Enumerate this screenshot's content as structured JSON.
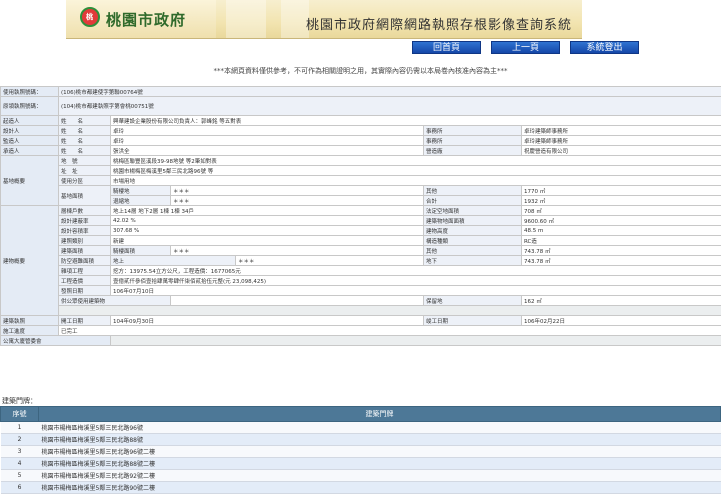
{
  "header": {
    "logo_text": "桃",
    "city_name": "桃園市政府",
    "system_title": "桃園市政府網際網路執照存根影像查詢系統"
  },
  "nav": {
    "home": "回首頁",
    "back": "上一頁",
    "logout": "系統登出"
  },
  "notice": "***本網頁資料僅供參考，不可作為相關證明之用，其實際內容仍需以本局卷內核准內容為主***",
  "license": {
    "use_label": "使用執照號碼：",
    "use_value": "(106)桃市都建使字第聯00764號",
    "orig_label": "原領執照號碼：",
    "orig_value": "(104)桃市都建執照字第會桃00751號"
  },
  "people": {
    "starter": {
      "label": "起造人",
      "name_label": "姓　　名",
      "name": "興華建設企業股份有限公司負責人：郭峰銘 等五對表"
    },
    "designer": {
      "label": "設計人",
      "name_label": "姓　　名",
      "name": "卓玲",
      "office_label": "事務所",
      "office": "卓玲建築師事務所"
    },
    "supervisor": {
      "label": "監造人",
      "name_label": "姓　　名",
      "name": "卓玲",
      "office_label": "事務所",
      "office": "卓玲建築師事務所"
    },
    "contractor": {
      "label": "承造人",
      "name_label": "姓　　名",
      "name": "張洪全",
      "office_label": "營造廠",
      "office": "祝慶營造有限公司"
    }
  },
  "site": {
    "label": "基地概要",
    "lot_label": "地　號",
    "lot": "桃梅區聯豐區溪段39-98地號 等2筆如對表",
    "addr_label": "址　址",
    "addr": "桃園市楊梅區梅溪里5鄰三民北路96號 等",
    "zone_label": "使用分區",
    "zone": "市場用地",
    "area_label": "基地面積",
    "arcade_label": "騎樓地",
    "arcade": "＊＊＊",
    "other_label": "其他",
    "other": "1770 ㎡",
    "setback_label": "退縮地",
    "setback": "＊＊＊",
    "total_label": "合計",
    "total": "1932 ㎡"
  },
  "building": {
    "label": "建物概要",
    "floors_label": "層棟戶數",
    "floors": "地上14層 地下2層 1棟 1棟 34戶",
    "legal_space_label": "法定空地面積",
    "legal_space": "708 ㎡",
    "coverage_label": "設計建蔽率",
    "coverage": "42.02 %",
    "building_area_label": "建築物地面面積",
    "building_area": "9600.60 ㎡",
    "far_label": "設計容積率",
    "far": "307.68 %",
    "height_label": "建物高度",
    "height": "48.5 m",
    "type_label": "建照類別",
    "type": "新建",
    "structure_label": "構造種類",
    "structure": "RC造",
    "floor_area_label": "建築面積",
    "floor_arcade_label": "騎樓面積",
    "floor_arcade": "＊＊＊",
    "floor_other_label": "其他",
    "floor_other": "743.78 ㎡",
    "shelter_label": "防空避難面積",
    "shelter_above_label": "地上",
    "shelter_above": "＊＊＊",
    "shelter_below_label": "地下",
    "shelter_below": "743.78 ㎡",
    "misc_label": "雜項工程",
    "misc": "挖方：13975.54立方公尺，工程造價：1677065元",
    "cost_label": "工程造價",
    "cost": "壹億貳仟參佰壹拾肆萬零肆仟柒佰貳拾伍元整(元 23,098,425)",
    "issue_label": "發照日期",
    "issue": "106年07月10日",
    "public_label": "供公眾使用建築物",
    "reserve_label": "保留地",
    "reserve": "162 ㎡"
  },
  "schedule": {
    "label": "建築執照",
    "start_label": "開工日期",
    "start": "104年09月30日",
    "finish_label": "竣工日期",
    "finish": "106年02月22日"
  },
  "progress": {
    "label": "施工進度",
    "value": "已完工"
  },
  "committee": {
    "label": "公寓大廈管委會",
    "value": ""
  },
  "doors": {
    "title": "建築門牌：",
    "col_no": "序號",
    "col_addr": "建築門牌",
    "rows": [
      {
        "no": "1",
        "addr": "桃園市楊梅區梅溪里5鄰三民北路96號"
      },
      {
        "no": "2",
        "addr": "桃園市楊梅區梅溪里5鄰三民北路88號"
      },
      {
        "no": "3",
        "addr": "桃園市楊梅區梅溪里5鄰三民北路96號二樓"
      },
      {
        "no": "4",
        "addr": "桃園市楊梅區梅溪里5鄰三民北路88號二樓"
      },
      {
        "no": "5",
        "addr": "桃園市楊梅區梅溪里5鄰三民北路92號二樓"
      },
      {
        "no": "6",
        "addr": "桃園市楊梅區梅溪里5鄰三民北路90號二樓"
      }
    ]
  }
}
